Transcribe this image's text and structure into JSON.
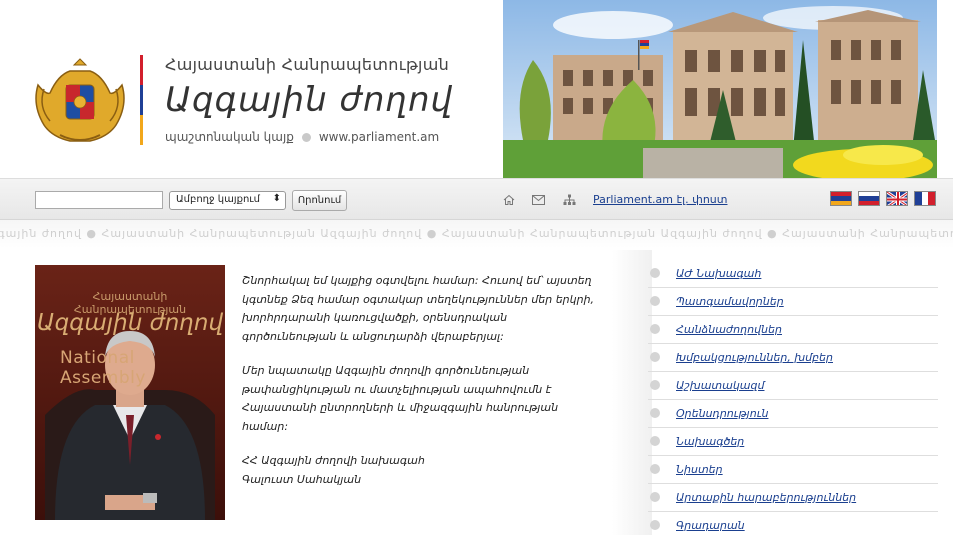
{
  "header": {
    "subtitle": "Հայաստանի Հանրապետության",
    "title": "Ազգային ժողով",
    "official_site": "պաշտոնական կայք",
    "domain": "www.parliament.am",
    "stripe_colors": [
      "#d21f2c",
      "#1f3f96",
      "#f2a71b"
    ]
  },
  "toolbar": {
    "search_value": "",
    "search_scope": "Ամբողջ կայքում",
    "search_button": "Որոնում",
    "home_icon": "home-icon",
    "mail_icon": "mail-icon",
    "sitemap_icon": "sitemap-icon",
    "tv_link": "Parliament.am էլ. փոստ",
    "flags": [
      "armenia-flag",
      "russia-flag",
      "uk-flag",
      "france-flag"
    ]
  },
  "watermark": "Ազգային ժողով ● Հայաստանի Հանրապետության Ազգային ժողով ● Հայաստանի Հանրապետության Ազգային ժողով ● Հայաստանի Հանրապետության Ազգային ժողով ● Հայաստանի Հանրապետության Ազգային ժողով ● Հայաստանի Հանրապետության",
  "portrait": {
    "sub": "Հայաստանի Հանրապետության",
    "title": "Ազգային ժողով",
    "na": "National Assembly"
  },
  "welcome": {
    "p1": "Շնորհակալ եմ կայքից օգտվելու համար: Հուսով եմ՝ այստեղ կգտնեք Ձեզ համար օգտակար տեղեկություններ մեր երկրի, խորհրդարանի կառուցվածքի, օրենսդրական գործունեության և անցուդարձի վերաբերյալ:",
    "p2": "Մեր նպատակը Ազգային ժողովի գործունեության թափանցիկության ու մատչելիության ապահովումն է Հայաստանի ընտրողների և միջազգային հանրության համար:",
    "p3a": "ՀՀ Ազգային ժողովի նախագահ",
    "p3b": "Գալուստ Սահակյան"
  },
  "menu": [
    "ԱԺ Նախագահ",
    "Պատգամավորներ",
    "Հանձնաժողովներ",
    "Խմբակցություններ, խմբեր",
    "Աշխատակազմ",
    "Օրենսդրություն",
    "Նախագծեր",
    "Նիստեր",
    "Արտաքին հարաբերություններ",
    "Գրադարան"
  ]
}
